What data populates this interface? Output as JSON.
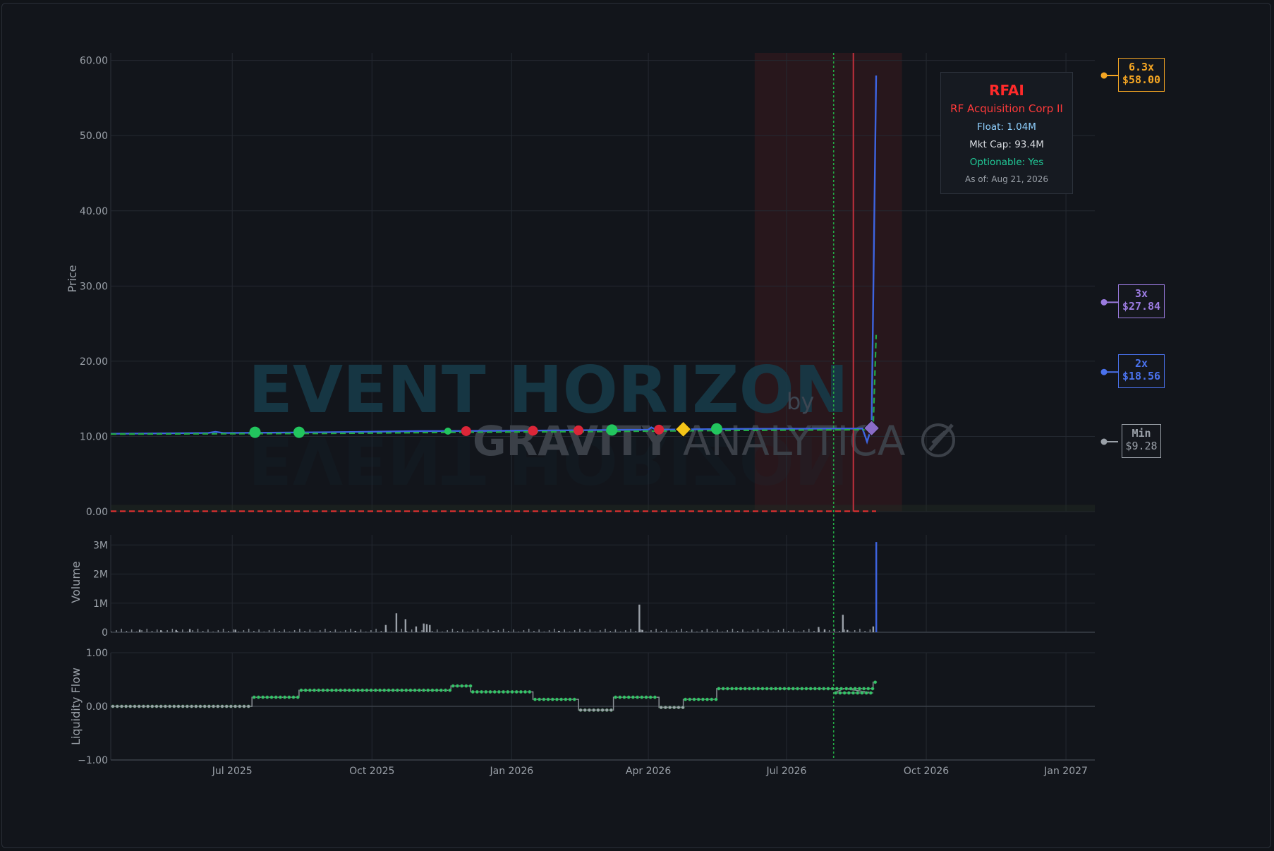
{
  "chart_data": {
    "type": "line",
    "watermark": {
      "line1": "EVENT HORIZON",
      "by": "by",
      "brand_bold": "GRAVITY",
      "brand_light": "ANALYTICA"
    },
    "x_ticks": [
      "Jul 2025",
      "Oct 2025",
      "Jan 2026",
      "Apr 2026",
      "Jul 2026",
      "Oct 2026",
      "Jan 2027"
    ],
    "x_range": [
      "2025-04-12",
      "2027-01-20"
    ],
    "panels": {
      "price": {
        "ylabel": "Price",
        "ylim": [
          0,
          61
        ],
        "yticks": [
          "0.00",
          "10.00",
          "20.00",
          "30.00",
          "40.00",
          "50.00",
          "60.00"
        ],
        "series": [
          {
            "style": "solid",
            "color": "#3d64e0",
            "points": [
              [
                "2025-04-12",
                10.35
              ],
              [
                "2025-06-15",
                10.45
              ],
              [
                "2025-06-20",
                10.6
              ],
              [
                "2025-06-25",
                10.45
              ],
              [
                "2025-09-01",
                10.55
              ],
              [
                "2025-11-01",
                10.7
              ],
              [
                "2026-01-01",
                10.75
              ],
              [
                "2026-03-01",
                10.85
              ],
              [
                "2026-04-01",
                10.9
              ],
              [
                "2026-04-03",
                11.2
              ],
              [
                "2026-04-06",
                10.9
              ],
              [
                "2026-06-01",
                11.0
              ],
              [
                "2026-08-20",
                11.05
              ],
              [
                "2026-08-22",
                9.9
              ],
              [
                "2026-08-23",
                9.28
              ],
              [
                "2026-08-26",
                11.2
              ],
              [
                "2026-08-29",
                58.0
              ]
            ]
          },
          {
            "style": "dashed",
            "color": "#22aa44",
            "points": [
              [
                "2025-04-12",
                10.3
              ],
              [
                "2025-09-01",
                10.4
              ],
              [
                "2025-12-01",
                10.55
              ],
              [
                "2026-03-01",
                10.65
              ],
              [
                "2026-06-01",
                10.8
              ],
              [
                "2026-08-27",
                10.9
              ],
              [
                "2026-08-28",
                17.0
              ],
              [
                "2026-08-29",
                23.5
              ]
            ]
          },
          {
            "style": "dashed",
            "color": "#e03030",
            "points": [
              [
                "2025-04-12",
                0.05
              ],
              [
                "2026-08-29",
                0.05
              ]
            ]
          }
        ],
        "markers": [
          {
            "date": "2025-07-16",
            "price": 10.55,
            "type": "circle",
            "color": "#22c55e",
            "size": "large"
          },
          {
            "date": "2025-08-14",
            "price": 10.55,
            "type": "circle",
            "color": "#22c55e",
            "size": "large"
          },
          {
            "date": "2025-11-20",
            "price": 10.7,
            "type": "circle",
            "color": "#22c55e",
            "size": "small"
          },
          {
            "date": "2025-12-02",
            "price": 10.7,
            "type": "circle",
            "color": "#dc2638",
            "size": "medium"
          },
          {
            "date": "2026-01-15",
            "price": 10.75,
            "type": "circle",
            "color": "#dc2638",
            "size": "medium"
          },
          {
            "date": "2026-02-14",
            "price": 10.8,
            "type": "circle",
            "color": "#dc2638",
            "size": "medium"
          },
          {
            "date": "2026-03-08",
            "price": 10.85,
            "type": "circle",
            "color": "#22c55e",
            "size": "large"
          },
          {
            "date": "2026-04-08",
            "price": 10.9,
            "type": "circle",
            "color": "#dc2638",
            "size": "medium"
          },
          {
            "date": "2026-04-24",
            "price": 10.95,
            "type": "diamond",
            "color": "#f5c518",
            "size": "large"
          },
          {
            "date": "2026-05-16",
            "price": 11.0,
            "type": "circle",
            "color": "#22c55e",
            "size": "large"
          },
          {
            "date": "2026-08-26",
            "price": 11.1,
            "type": "diamond",
            "color": "#8a6cc6",
            "size": "large"
          }
        ],
        "shaded_region": {
          "start": "2026-06-10",
          "end": "2026-09-15",
          "color": "#3a1a1e"
        },
        "vlines": [
          {
            "date": "2026-08-01",
            "color": "#22aa44",
            "style": "dotted",
            "panels": "all"
          },
          {
            "date": "2026-08-14",
            "color": "#c0303c",
            "style": "solid",
            "panels": "price"
          }
        ]
      },
      "volume": {
        "ylabel": "Volume",
        "ylim": [
          0,
          3200000
        ],
        "yticks": [
          "0",
          "1M",
          "2M",
          "3M"
        ],
        "spikes": [
          [
            "2025-05-01",
            90000
          ],
          [
            "2025-05-15",
            70000
          ],
          [
            "2025-05-25",
            80000
          ],
          [
            "2025-06-03",
            110000
          ],
          [
            "2025-07-03",
            90000
          ],
          [
            "2025-09-20",
            50000
          ],
          [
            "2025-10-10",
            250000
          ],
          [
            "2025-10-17",
            650000
          ],
          [
            "2025-10-23",
            450000
          ],
          [
            "2025-10-30",
            200000
          ],
          [
            "2025-11-04",
            300000
          ],
          [
            "2025-11-06",
            280000
          ],
          [
            "2025-11-08",
            250000
          ],
          [
            "2025-12-20",
            40000
          ],
          [
            "2026-02-01",
            50000
          ],
          [
            "2026-03-26",
            950000
          ],
          [
            "2026-03-28",
            80000
          ],
          [
            "2026-07-22",
            180000
          ],
          [
            "2026-07-26",
            100000
          ],
          [
            "2026-08-07",
            600000
          ],
          [
            "2026-08-10",
            80000
          ],
          [
            "2026-08-27",
            200000
          ],
          [
            "2026-08-29",
            3100000
          ]
        ]
      },
      "liquidity_flow": {
        "ylabel": "Liquidity Flow",
        "ylim": [
          -1,
          1
        ],
        "yticks": [
          "−1.00",
          "0.00",
          "1.00"
        ],
        "steps": [
          {
            "start": "2025-04-12",
            "end": "2025-07-14",
            "value": 0.0
          },
          {
            "start": "2025-07-14",
            "end": "2025-08-14",
            "value": 0.17
          },
          {
            "start": "2025-08-14",
            "end": "2025-11-22",
            "value": 0.3
          },
          {
            "start": "2025-11-22",
            "end": "2025-12-05",
            "value": 0.38
          },
          {
            "start": "2025-12-05",
            "end": "2026-01-15",
            "value": 0.27
          },
          {
            "start": "2026-01-15",
            "end": "2026-02-14",
            "value": 0.13
          },
          {
            "start": "2026-02-14",
            "end": "2026-03-09",
            "value": -0.07
          },
          {
            "start": "2026-03-09",
            "end": "2026-04-08",
            "value": 0.17
          },
          {
            "start": "2026-04-08",
            "end": "2026-04-24",
            "value": -0.02
          },
          {
            "start": "2026-04-24",
            "end": "2026-05-16",
            "value": 0.13
          },
          {
            "start": "2026-05-16",
            "end": "2026-08-08",
            "value": 0.33
          },
          {
            "start": "2026-08-01",
            "end": "2026-08-27",
            "value": 0.25
          },
          {
            "start": "2026-08-08",
            "end": "2026-08-27",
            "value": 0.33
          },
          {
            "start": "2026-08-27",
            "end": "2026-08-29",
            "value": 0.45
          }
        ]
      }
    }
  },
  "info": {
    "symbol": "RFAI",
    "name": "RF Acquisition Corp II",
    "float": "Float: 1.04M",
    "mkt_cap": "Mkt Cap: 93.4M",
    "optionable": "Optionable: Yes",
    "as_of": "As of: Aug 21, 2026"
  },
  "price_levels": [
    {
      "label": "6.3x",
      "price_text": "$58.00",
      "price": 58.0,
      "color": "#f5a623"
    },
    {
      "label": "3x",
      "price_text": "$27.84",
      "price": 27.84,
      "color": "#9b7be0"
    },
    {
      "label": "2x",
      "price_text": "$18.56",
      "price": 18.56,
      "color": "#4a72ee"
    },
    {
      "label": "Min",
      "price_text": "$9.28",
      "price": 9.28,
      "color": "#9aa0a8"
    }
  ]
}
